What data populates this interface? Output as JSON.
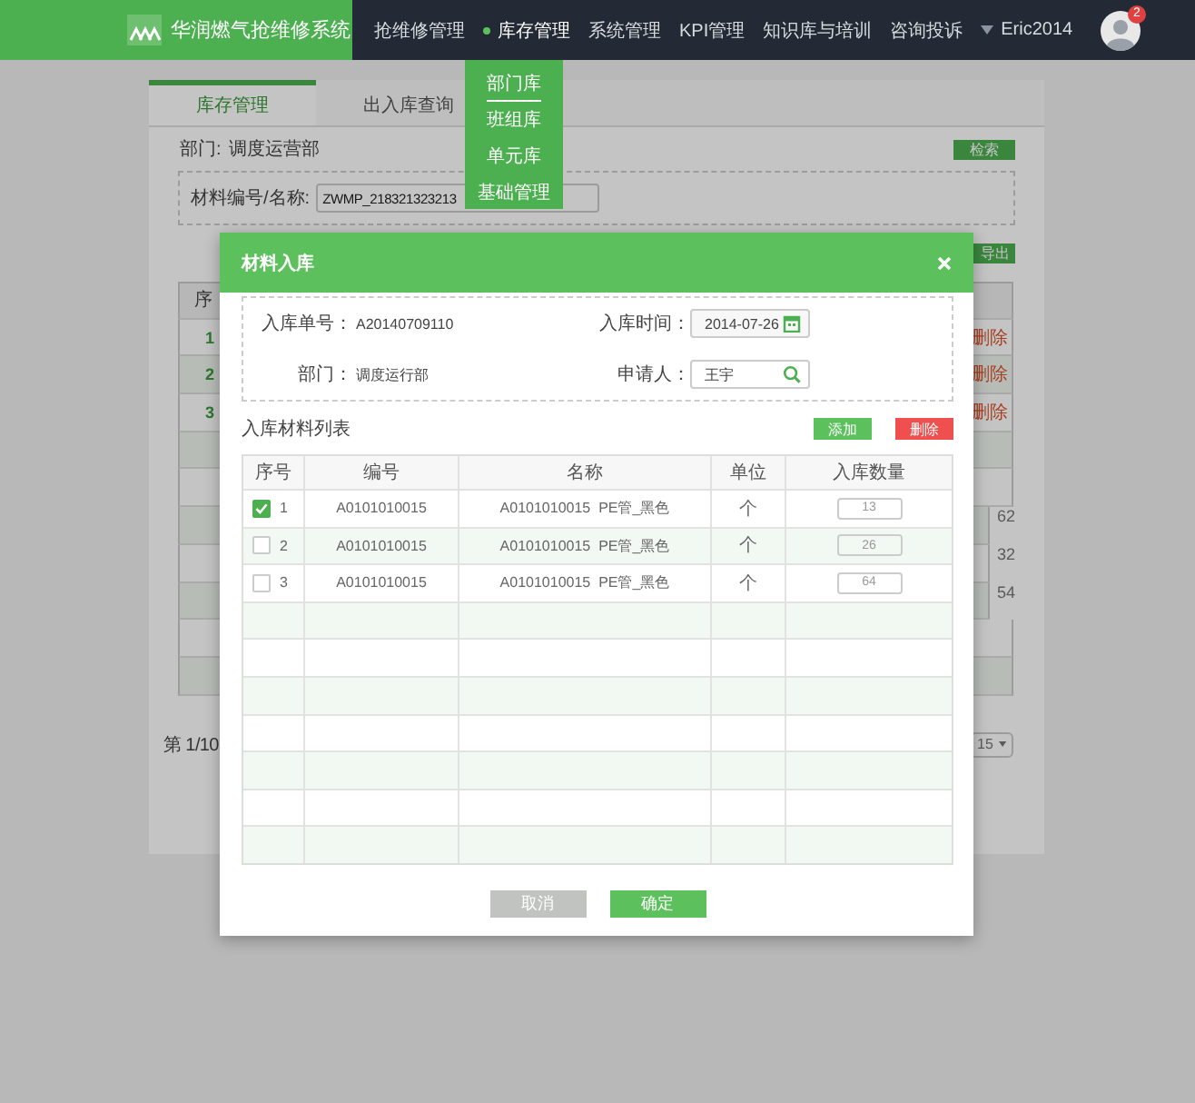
{
  "app": {
    "title": "华润燃气抢维修系统"
  },
  "nav": [
    {
      "label": "抢维修管理",
      "selected": false
    },
    {
      "label": "库存管理",
      "selected": true
    },
    {
      "label": "系统管理",
      "selected": false
    },
    {
      "label": "KPI管理",
      "selected": false
    },
    {
      "label": "知识库与培训",
      "selected": false
    },
    {
      "label": "咨询投诉",
      "selected": false
    }
  ],
  "user": {
    "name": "Eric2014",
    "badge": "2"
  },
  "nav_dropdown": [
    {
      "label": "部门库",
      "selected": true
    },
    {
      "label": "班组库",
      "selected": false
    },
    {
      "label": "单元库",
      "selected": false
    },
    {
      "label": "基础管理",
      "selected": false
    }
  ],
  "page": {
    "tabs": [
      {
        "label": "库存管理",
        "selected": true
      },
      {
        "label": "出入库查询",
        "selected": false
      }
    ],
    "department_label": "部门:",
    "department_value": "调度运营部",
    "search_button": "检索",
    "filter_label": "材料编号/名称:",
    "filter_value": "ZWMP_218321323213",
    "export_button": "导出",
    "table_header": "序",
    "rows": [
      {
        "index": "1",
        "action": "删除"
      },
      {
        "index": "2",
        "action": "删除"
      },
      {
        "index": "3",
        "action": "删除"
      }
    ],
    "side_values": [
      "62",
      "32",
      "54"
    ],
    "pagination": "第 1/10",
    "page_size": "15"
  },
  "dialog": {
    "title": "材料入库",
    "order_label": "入库单号：",
    "order_no": "A20140709110",
    "time_label": "入库时间：",
    "time_value": "2014-07-26",
    "dept_label": "部门：",
    "dept_value": "调度运行部",
    "applicant_label": "申请人：",
    "applicant_value": "王宇",
    "list_title": "入库材料列表",
    "add_button": "添加",
    "delete_button": "删除",
    "columns": [
      "序号",
      "编号",
      "名称",
      "单位",
      "入库数量"
    ],
    "rows": [
      {
        "checked": true,
        "index": "1",
        "code": "A0101010015",
        "name": "A0101010015  PE管_黑色",
        "unit": "个",
        "quantity": "13"
      },
      {
        "checked": false,
        "index": "2",
        "code": "A0101010015",
        "name": "A0101010015  PE管_黑色",
        "unit": "个",
        "quantity": "26"
      },
      {
        "checked": false,
        "index": "3",
        "code": "A0101010015",
        "name": "A0101010015  PE管_黑色",
        "unit": "个",
        "quantity": "64"
      }
    ],
    "cancel_button": "取消",
    "confirm_button": "确定"
  }
}
